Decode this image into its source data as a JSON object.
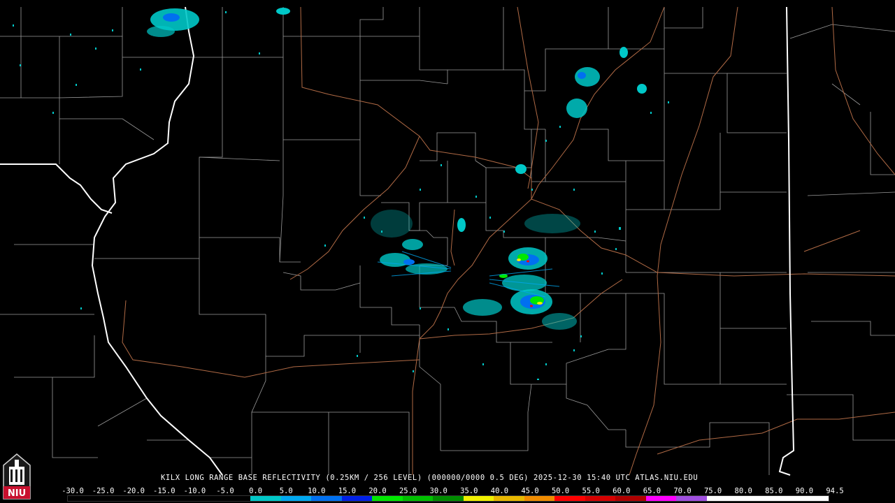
{
  "product": {
    "title": "KILX LONG RANGE BASE REFLECTIVITY (0.25KM / 256 LEVEL) (000000/0000 0.5 DEG) 2025-12-30 15:40 UTC  ATLAS.NIU.EDU"
  },
  "logo": {
    "text": "NIU"
  },
  "colors": {
    "background": "#000000",
    "county_lines": "#9a9a9a",
    "state_lines": "#ffffff",
    "highways": "#b06a45"
  },
  "legend": {
    "labels": [
      "-30.0",
      "-25.0",
      "-20.0",
      "-15.0",
      "-10.0",
      "-5.0",
      "0.0",
      "5.0",
      "10.0",
      "15.0",
      "20.0",
      "25.0",
      "30.0",
      "35.0",
      "40.0",
      "45.0",
      "50.0",
      "55.0",
      "60.0",
      "65.0",
      "70.0",
      "75.0",
      "80.0",
      "85.0",
      "90.0",
      "94.5"
    ],
    "colors": [
      "#000000",
      "#000000",
      "#000000",
      "#000000",
      "#000000",
      "#000000",
      "#00c8c8",
      "#00a8f0",
      "#0070f0",
      "#0020e8",
      "#00e800",
      "#00c000",
      "#008c00",
      "#f0f000",
      "#e8b800",
      "#f08c00",
      "#ff0000",
      "#d60000",
      "#b00000",
      "#ff00ff",
      "#a050e0",
      "#ffffff",
      "#ffffff",
      "#ffffff",
      "#ffffff"
    ]
  }
}
